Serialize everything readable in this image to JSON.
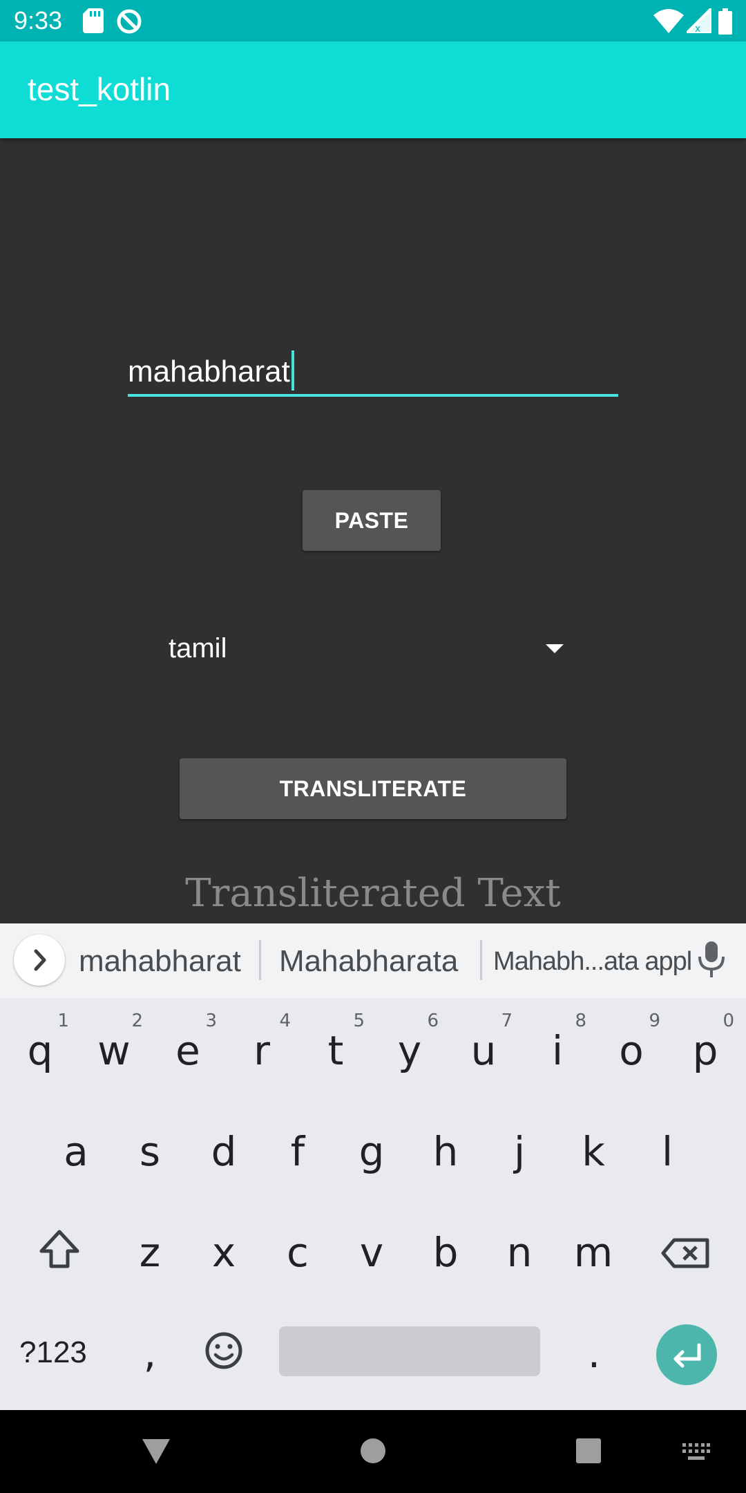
{
  "status_bar": {
    "time": "9:33",
    "left_icons": [
      "sd-card-icon",
      "sync-disabled-icon"
    ],
    "right_icons": [
      "wifi-icon",
      "signal-icon",
      "battery-icon"
    ]
  },
  "app_bar": {
    "title": "test_kotlin"
  },
  "main": {
    "input_value": "mahabharat",
    "paste_label": "PASTE",
    "language_selected": "tamil",
    "transliterate_label": "TRANSLITERATE",
    "transliterated_text": "Transliterated Text"
  },
  "keyboard": {
    "suggestions": [
      "mahabharat",
      "Mahabharata",
      "Mahabh...ata appl"
    ],
    "row1": [
      {
        "key": "q",
        "hint": "1"
      },
      {
        "key": "w",
        "hint": "2"
      },
      {
        "key": "e",
        "hint": "3"
      },
      {
        "key": "r",
        "hint": "4"
      },
      {
        "key": "t",
        "hint": "5"
      },
      {
        "key": "y",
        "hint": "6"
      },
      {
        "key": "u",
        "hint": "7"
      },
      {
        "key": "i",
        "hint": "8"
      },
      {
        "key": "o",
        "hint": "9"
      },
      {
        "key": "p",
        "hint": "0"
      }
    ],
    "row2": [
      "a",
      "s",
      "d",
      "f",
      "g",
      "h",
      "j",
      "k",
      "l"
    ],
    "row3": [
      "z",
      "x",
      "c",
      "v",
      "b",
      "n",
      "m"
    ],
    "symbols_label": "?123",
    "comma_label": ",",
    "period_label": ".",
    "accent_color": "#4DB6AC"
  },
  "colors": {
    "status_bar": "#00B3B3",
    "app_bar": "#10DCD6",
    "background": "#303030",
    "input_accent": "#48E3DE",
    "button": "#555557"
  }
}
